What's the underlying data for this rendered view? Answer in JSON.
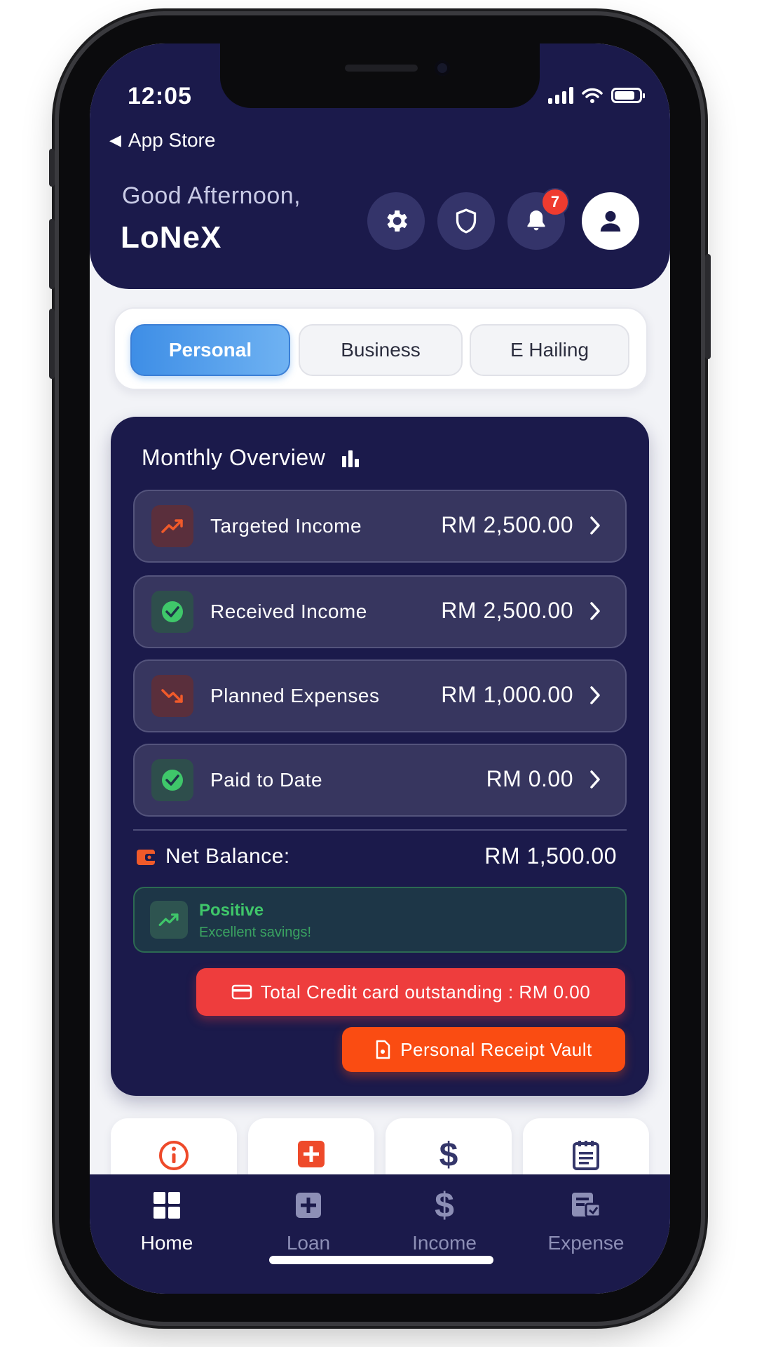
{
  "status_bar": {
    "time": "12:05"
  },
  "back_link": {
    "label": "App Store"
  },
  "header": {
    "greeting": "Good Afternoon,",
    "username": "LoNeX",
    "notification_count": "7",
    "icons": [
      "gear-icon",
      "shield-icon",
      "bell-icon",
      "user-icon"
    ]
  },
  "tabs": [
    {
      "label": "Personal",
      "active": true
    },
    {
      "label": "Business",
      "active": false
    },
    {
      "label": "E Hailing",
      "active": false
    }
  ],
  "overview": {
    "title": "Monthly Overview",
    "rows": [
      {
        "label": "Targeted Income",
        "value": "RM 2,500.00",
        "icon": "trend-up-icon"
      },
      {
        "label": "Received Income",
        "value": "RM 2,500.00",
        "icon": "check-circle-icon"
      },
      {
        "label": "Planned Expenses",
        "value": "RM 1,000.00",
        "icon": "trend-down-icon"
      },
      {
        "label": "Paid to Date",
        "value": "RM 0.00",
        "icon": "check-circle-icon"
      }
    ],
    "net_balance": {
      "label": "Net Balance:",
      "value": "RM 1,500.00"
    },
    "status": {
      "title": "Positive",
      "subtitle": "Excellent savings!"
    },
    "credit_button": "Total Credit card outstanding : RM 0.00",
    "vault_button": "Personal Receipt Vault"
  },
  "bottom_nav": [
    {
      "label": "Home",
      "active": true
    },
    {
      "label": "Loan",
      "active": false
    },
    {
      "label": "Income",
      "active": false
    },
    {
      "label": "Expense",
      "active": false
    }
  ],
  "colors": {
    "navy": "#1b1a4b",
    "accent_blue": "#3e8ee6",
    "danger_red": "#ee3d3d",
    "orange": "#fa4c12",
    "positive_green": "#3fc76a"
  }
}
